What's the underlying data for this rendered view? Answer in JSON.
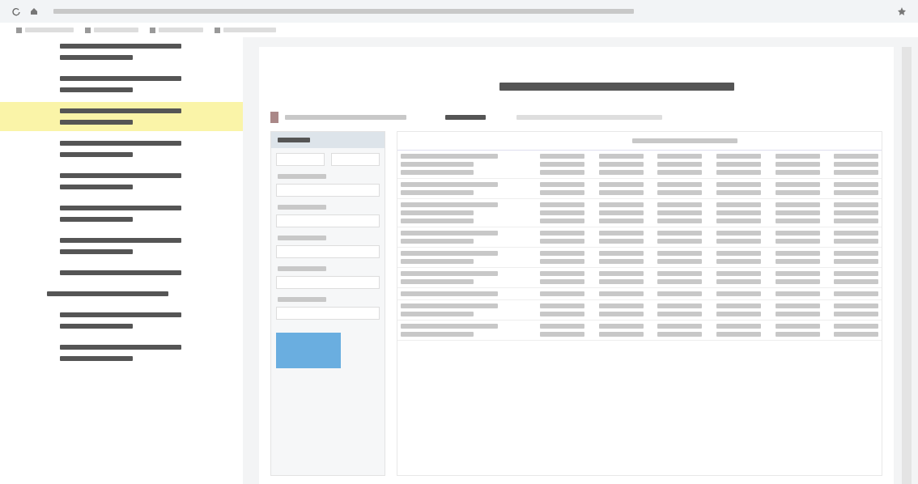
{
  "sidebar": {
    "items": [
      {
        "kind": "item",
        "selected": false
      },
      {
        "kind": "item",
        "selected": false
      },
      {
        "kind": "item",
        "selected": true
      },
      {
        "kind": "item",
        "selected": false
      },
      {
        "kind": "item",
        "selected": false
      },
      {
        "kind": "item",
        "selected": false
      },
      {
        "kind": "item",
        "selected": false
      },
      {
        "kind": "single",
        "selected": false
      },
      {
        "kind": "header",
        "selected": false
      },
      {
        "kind": "item",
        "selected": false
      },
      {
        "kind": "item",
        "selected": false
      }
    ]
  },
  "form": {
    "fields": [
      {
        "kind": "pair"
      },
      {
        "kind": "field"
      },
      {
        "kind": "field"
      },
      {
        "kind": "field"
      },
      {
        "kind": "field"
      },
      {
        "kind": "field"
      }
    ]
  },
  "table": {
    "rows": [
      {
        "kind": "block"
      },
      {
        "kind": "pair"
      },
      {
        "kind": "block"
      },
      {
        "kind": "pair"
      },
      {
        "kind": "pair"
      },
      {
        "kind": "pair"
      },
      {
        "kind": "single"
      },
      {
        "kind": "pair"
      },
      {
        "kind": "pair"
      }
    ]
  }
}
